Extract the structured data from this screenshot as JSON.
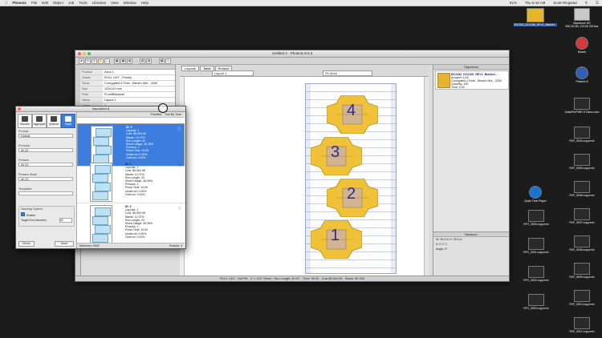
{
  "menubar": {
    "app_name": "Phoenix",
    "items": [
      "File",
      "Edit",
      "Object",
      "Job",
      "Tools",
      "Libraries",
      "View",
      "Window",
      "Help"
    ],
    "battery": "91%",
    "clock": "Thu 6:43 AM",
    "user": "Scott Ringstad"
  },
  "main_window": {
    "title": "Untitled 3 - Phoenix 8.0.3",
    "status": "ROLL OUT - Not Ple - 4\" x 120\" Sheet - Run Length: 20.00\" - Time: 00:00 - Cost:$5,064.08 - Waste: $0.000"
  },
  "properties": {
    "title": "Properties",
    "rows": [
      {
        "k": "Product",
        "v": "Zone 1"
      },
      {
        "k": "Grade",
        "v": "ROLL OUT - Priority"
      },
      {
        "k": "Stock",
        "v": "Corrugated 4 Flute - Bleach Wht - 200#"
      },
      {
        "k": "Size",
        "v": "120x120 mm"
      },
      {
        "k": "Path",
        "v": "Front/Backside"
      },
      {
        "k": "Name",
        "v": "Layout 1"
      },
      {
        "k": "Order",
        "v": "1"
      },
      {
        "k": "CAD Plan",
        "v": ""
      }
    ]
  },
  "layout_area": {
    "tabs": [
      "Layouts",
      "Table",
      "Product"
    ],
    "layout_select": "Layout 1",
    "view_select": "Fit Work"
  },
  "right_panel": {
    "title": "Objectives",
    "item_title": "BC2332_DC4156_REV1_Blanket...",
    "item_lines": [
      "Arrayed: 1/16",
      "Corrugated 4 Flute - Bleach Wht - 200#",
      "Quantity: 150",
      "Time: 0:00"
    ],
    "measure_title": "Measure",
    "measure_rows": [
      "W: 30.0 in  H: 30.0 in",
      "X: 0  Y: 0",
      "Angle: 0°"
    ]
  },
  "float_window": {
    "title": "Imposition 8",
    "modes": [
      "Random",
      "Aggregate",
      "Optimize",
      "Rapid"
    ],
    "fields": [
      {
        "label": "Product",
        "value": "Default"
      },
      {
        "label": "Products",
        "value": "All (3)"
      },
      {
        "label": "Presses",
        "value": "All (3)"
      },
      {
        "label": "Presses Mode",
        "value": "All (3)"
      },
      {
        "label": "Templates",
        "value": ""
      }
    ],
    "group_title": "Stacking Options",
    "group_option": "Enable",
    "group_field_label": "Target Run (minutes)",
    "group_field_value": "60",
    "bottom_buttons": [
      "Rerun",
      "Done"
    ],
    "list_header_left": "Priorities",
    "list_header_right": "Sort By Time",
    "results": [
      {
        "title": "ID: 3",
        "lines": [
          "Layouts: 1",
          "Cost: $5,064.08",
          "Waste: 12.07%",
          "Run Length: 20",
          "Sheet Usage: 46.28%",
          "Presses: 1",
          "Press Time: 10:00",
          "Underrun: 0.00%",
          "Overrun: 0.00%"
        ]
      },
      {
        "title": "ID: 1",
        "lines": [
          "Layouts: 1",
          "Cost: $5,064.08",
          "Waste: 12.07%",
          "Run Length: 20",
          "Sheet Usage: 46.28%",
          "Presses: 1",
          "Press Time: 10:00",
          "Underrun: 0.00%",
          "Overrun: 0.00%"
        ]
      },
      {
        "title": "ID: 2",
        "lines": [
          "Layouts: 1",
          "Cost: $5,064.08",
          "Waste: 12.07%",
          "Run Length: 20",
          "Sheet Usage: 46.28%",
          "Presses: 1",
          "Press Time: 10:00",
          "Underrun: 0.00%",
          "Overrun: 0.00%"
        ]
      }
    ],
    "status_left": "Minimum: 0000",
    "status_right": "Results: 3"
  },
  "pieces": [
    "4",
    "3",
    "2",
    "1"
  ],
  "desktop": {
    "top_file": "BC2332_DC4156_REV1_Blanket...",
    "drive": "Macintosh HD",
    "drive_sub": "500.28 GB, 213.59 GB free",
    "apps": [
      "Munch",
      "Phoenix 8",
      "Quick Time Player"
    ],
    "files_col1": [
      "RFV_0000 copy.m4v",
      "RFV_0001 copy.m4v",
      "RFV_0002 copy.m4v",
      "RFV_0003 copy.m4v"
    ],
    "files_col2": [
      "JulianFerPHB7.5 Demo.mov",
      "RVF_0004 copy.m4v",
      "RVF_0005 copy.m4v",
      "RVF_0006 copy.m4v",
      "RVF_0007 copy.m4v",
      "RVF_0008 copy.m4v",
      "RVF_0009 copy.m4v",
      "RVF_0010 copy.m4v",
      "RVF_0011 copy.m4v"
    ]
  },
  "colors": {
    "accent": "#3b7ee0",
    "piece": "#f0c23a",
    "piece_edge": "#b88a10",
    "piece_core": "#d2b394",
    "digit": "#2a2a9a"
  }
}
